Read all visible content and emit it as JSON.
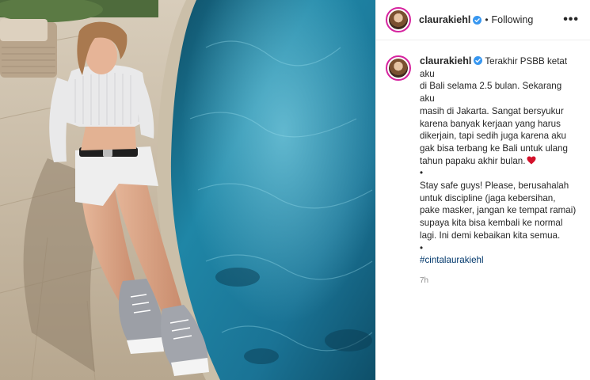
{
  "post": {
    "username": "claurakiehl",
    "follow_status": "Following",
    "more_icon": "•••",
    "caption_lines": [
      "Terakhir PSBB ketat aku",
      "di Bali selama 2.5 bulan. Sekarang aku",
      "masih di Jakarta. Sangat bersyukur",
      "karena banyak kerjaan yang harus",
      "dikerjain, tapi sedih juga karena aku",
      "gak bisa terbang ke Bali untuk ulang",
      "tahun papaku akhir bulan.",
      "•",
      "Stay safe guys! Please, berusahalah",
      "untuk discipline (jaga kebersihan,",
      "pake masker, jangan ke tempat ramai)",
      "supaya kita bisa kembali ke normal",
      "lagi. Ini demi kebaikan kita semua.",
      "•"
    ],
    "hashtag": "#cintalaurakiehl",
    "timestamp": "7h"
  },
  "icons": {
    "verified": "verified-badge-icon",
    "heart": "red-heart-emoji",
    "more": "more-options-icon"
  },
  "colors": {
    "verified_blue": "#3897f0",
    "hashtag_blue": "#00376b",
    "heart_red": "#d4112b",
    "pool_water": "#1e7f9f"
  }
}
